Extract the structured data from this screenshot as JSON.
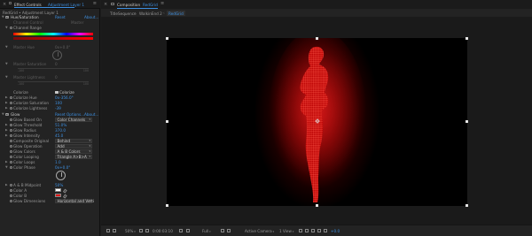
{
  "effect_controls": {
    "close_glyph": "×",
    "tab_label": "Effect Controls",
    "layer_name": "Adjustment Layer 1",
    "menu_glyph": "≡",
    "path": "RedGrid • Adjustment Layer 1"
  },
  "hue_saturation": {
    "name": "Hue/Saturation",
    "reset": "Reset",
    "about": "About...",
    "channel_control_label": "Channel Control",
    "channel_control_value": "Master",
    "channel_range_label": "Channel Range",
    "master_hue_label": "Master Hue",
    "master_hue_value": "0x+0.0°",
    "master_saturation_label": "Master Saturation",
    "master_saturation_value": "0",
    "master_saturation_min": "-100",
    "master_saturation_max": "100",
    "master_lightness_label": "Master Lightness",
    "master_lightness_value": "0",
    "master_lightness_min": "-100",
    "master_lightness_max": "100",
    "colorize_label": "Colorize",
    "colorize_checkbox_label": "Colorize",
    "colorize_hue_label": "Colorize Hue",
    "colorize_hue_value": "0x-356.0°",
    "colorize_saturation_label": "Colorize Saturation",
    "colorize_saturation_value": "100",
    "colorize_lightness_label": "Colorize Lightness",
    "colorize_lightness_value": "-39"
  },
  "glow": {
    "name": "Glow",
    "reset": "Reset",
    "options": "Options...",
    "about": "About...",
    "params": [
      {
        "label": "Glow Based On",
        "value": "Color Channels",
        "kind": "dropdown"
      },
      {
        "label": "Glow Threshold",
        "value": "51.0%",
        "kind": "value"
      },
      {
        "label": "Glow Radius",
        "value": "370.0",
        "kind": "value"
      },
      {
        "label": "Glow Intensity",
        "value": "45.0",
        "kind": "value"
      },
      {
        "label": "Composite Original",
        "value": "Behind",
        "kind": "dropdown"
      },
      {
        "label": "Glow Operation",
        "value": "Add",
        "kind": "dropdown"
      },
      {
        "label": "Glow Colors",
        "value": "A & B Colors",
        "kind": "dropdown"
      },
      {
        "label": "Color Looping",
        "value": "Triangle A>B>A",
        "kind": "dropdown"
      },
      {
        "label": "Color Loops",
        "value": "1.0",
        "kind": "value"
      },
      {
        "label": "Color Phase",
        "value": "0x+0.0°",
        "kind": "value"
      }
    ],
    "ab_midpoint_label": "A & B Midpoint",
    "ab_midpoint_value": "50%",
    "color_a_label": "Color A",
    "color_a": "#ffffff",
    "color_b_label": "Color B",
    "color_b": "#e01414",
    "glow_dimensions_label": "Glow Dimensions",
    "glow_dimensions_value": "Horizontal and Verti"
  },
  "composition": {
    "close_glyph": "×",
    "tab_label": "Composition",
    "comp_name": "RedGrid",
    "menu_glyph": "≡",
    "breadcrumbs": [
      "TitleSequence",
      "WalkinEnd 2",
      "RedGrid"
    ],
    "crumb_sep": "‹",
    "canvas_colors": {
      "glow": "#ff1a1a",
      "background": "#000000"
    }
  },
  "viewer_bar": {
    "zoom": "50%",
    "timecode": "0:00:03:10",
    "resolution": "Full",
    "camera": "Active Camera",
    "views": "1 View",
    "exposure": "+0.0"
  }
}
